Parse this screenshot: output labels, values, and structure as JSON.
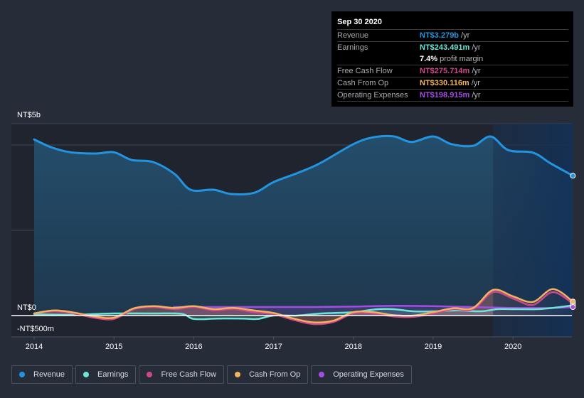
{
  "tooltip": {
    "date": "Sep 30 2020",
    "rows": [
      {
        "label": "Revenue",
        "value": "NT$3.279b",
        "suffix": "/yr",
        "color": "#2394df"
      },
      {
        "label": "Earnings",
        "value": "NT$243.491m",
        "suffix": "/yr",
        "color": "#6ce5d6"
      },
      {
        "label": "",
        "value": "7.4%",
        "suffix": "profit margin",
        "color": "#ffffff"
      },
      {
        "label": "Free Cash Flow",
        "value": "NT$275.714m",
        "suffix": "/yr",
        "color": "#d1478d"
      },
      {
        "label": "Cash From Op",
        "value": "NT$330.116m",
        "suffix": "/yr",
        "color": "#f1b45e"
      },
      {
        "label": "Operating Expenses",
        "value": "NT$198.915m",
        "suffix": "/yr",
        "color": "#a44de4"
      }
    ]
  },
  "legend": [
    {
      "label": "Revenue",
      "color": "#2394df"
    },
    {
      "label": "Earnings",
      "color": "#6ce5d6"
    },
    {
      "label": "Free Cash Flow",
      "color": "#d1478d"
    },
    {
      "label": "Cash From Op",
      "color": "#f1b45e"
    },
    {
      "label": "Operating Expenses",
      "color": "#a44de4"
    }
  ],
  "chart_data": {
    "type": "area",
    "title": "",
    "xlabel": "",
    "ylabel": "",
    "y_unit": "NT$ billions",
    "ylim": [
      -0.5,
      4.5
    ],
    "xlim": [
      2013.9,
      2020.75
    ],
    "x_ticks": [
      2014,
      2015,
      2016,
      2017,
      2018,
      2019,
      2020
    ],
    "x_tick_labels": [
      "2014",
      "2015",
      "2016",
      "2017",
      "2018",
      "2019",
      "2020"
    ],
    "y_tick_labels": [
      {
        "value": 5,
        "label": "NT$5b"
      },
      {
        "value": 0,
        "label": "NT$0"
      },
      {
        "value": -0.5,
        "label": "-NT$500m"
      }
    ],
    "gridlines": [
      0,
      2,
      4
    ],
    "grid": true,
    "highlight_region": [
      2019.75,
      2020.75
    ],
    "legend_position": "bottom",
    "series": [
      {
        "name": "Revenue",
        "color": "#2394df",
        "x": [
          2014.0,
          2014.21,
          2014.45,
          2014.78,
          2015.0,
          2015.22,
          2015.49,
          2015.76,
          2015.96,
          2016.25,
          2016.47,
          2016.76,
          2017.0,
          2017.31,
          2017.58,
          2018.0,
          2018.25,
          2018.51,
          2018.73,
          2019.0,
          2019.23,
          2019.5,
          2019.72,
          2019.94,
          2020.25,
          2020.47,
          2020.75
        ],
        "values": [
          4.13,
          3.95,
          3.83,
          3.8,
          3.83,
          3.65,
          3.6,
          3.32,
          2.95,
          2.95,
          2.85,
          2.88,
          3.13,
          3.35,
          3.57,
          4.02,
          4.18,
          4.2,
          4.07,
          4.2,
          4.02,
          3.98,
          4.2,
          3.88,
          3.82,
          3.57,
          3.28
        ]
      },
      {
        "name": "Earnings",
        "color": "#6ce5d6",
        "x": [
          2014.0,
          2014.5,
          2015.0,
          2015.5,
          2015.85,
          2016.0,
          2016.3,
          2016.6,
          2016.8,
          2017.0,
          2017.3,
          2017.6,
          2018.0,
          2018.3,
          2018.5,
          2018.75,
          2019.0,
          2019.3,
          2019.6,
          2019.8,
          2020.0,
          2020.3,
          2020.5,
          2020.75
        ],
        "values": [
          0.03,
          0.02,
          0.05,
          0.05,
          0.04,
          -0.08,
          -0.07,
          -0.07,
          -0.08,
          0.0,
          0.0,
          0.05,
          0.08,
          0.15,
          0.15,
          0.1,
          0.1,
          0.12,
          0.1,
          0.15,
          0.15,
          0.15,
          0.18,
          0.24
        ]
      },
      {
        "name": "Free Cash Flow",
        "color": "#d1478d",
        "x": [
          2014.0,
          2014.25,
          2014.5,
          2014.75,
          2015.0,
          2015.25,
          2015.5,
          2015.75,
          2016.0,
          2016.25,
          2016.5,
          2016.75,
          2017.0,
          2017.25,
          2017.5,
          2017.75,
          2018.0,
          2018.25,
          2018.5,
          2018.75,
          2019.0,
          2019.25,
          2019.5,
          2019.75,
          2020.0,
          2020.25,
          2020.5,
          2020.75
        ],
        "values": [
          0.05,
          0.1,
          0.05,
          -0.05,
          -0.08,
          0.15,
          0.2,
          0.15,
          0.2,
          0.12,
          0.15,
          0.08,
          0.03,
          -0.1,
          -0.2,
          -0.15,
          0.05,
          0.05,
          -0.02,
          -0.03,
          0.05,
          0.15,
          0.15,
          0.55,
          0.4,
          0.25,
          0.55,
          0.28
        ]
      },
      {
        "name": "Cash From Op",
        "color": "#f1b45e",
        "x": [
          2014.0,
          2014.25,
          2014.5,
          2014.75,
          2015.0,
          2015.25,
          2015.5,
          2015.75,
          2016.0,
          2016.25,
          2016.5,
          2016.75,
          2017.0,
          2017.25,
          2017.5,
          2017.75,
          2018.0,
          2018.25,
          2018.5,
          2018.75,
          2019.0,
          2019.25,
          2019.5,
          2019.75,
          2020.0,
          2020.25,
          2020.5,
          2020.75
        ],
        "values": [
          0.05,
          0.12,
          0.07,
          -0.02,
          -0.05,
          0.17,
          0.22,
          0.18,
          0.22,
          0.15,
          0.18,
          0.12,
          0.06,
          -0.07,
          -0.16,
          -0.12,
          0.08,
          0.08,
          0.01,
          0.0,
          0.08,
          0.17,
          0.18,
          0.6,
          0.45,
          0.32,
          0.62,
          0.33
        ]
      },
      {
        "name": "Operating Expenses",
        "color": "#a44de4",
        "x": [
          2015.75,
          2016.0,
          2016.5,
          2017.0,
          2017.5,
          2018.0,
          2018.5,
          2019.0,
          2019.5,
          2020.0,
          2020.5,
          2020.75
        ],
        "values": [
          0.2,
          0.2,
          0.2,
          0.2,
          0.2,
          0.21,
          0.23,
          0.22,
          0.2,
          0.18,
          0.18,
          0.2
        ]
      }
    ]
  }
}
